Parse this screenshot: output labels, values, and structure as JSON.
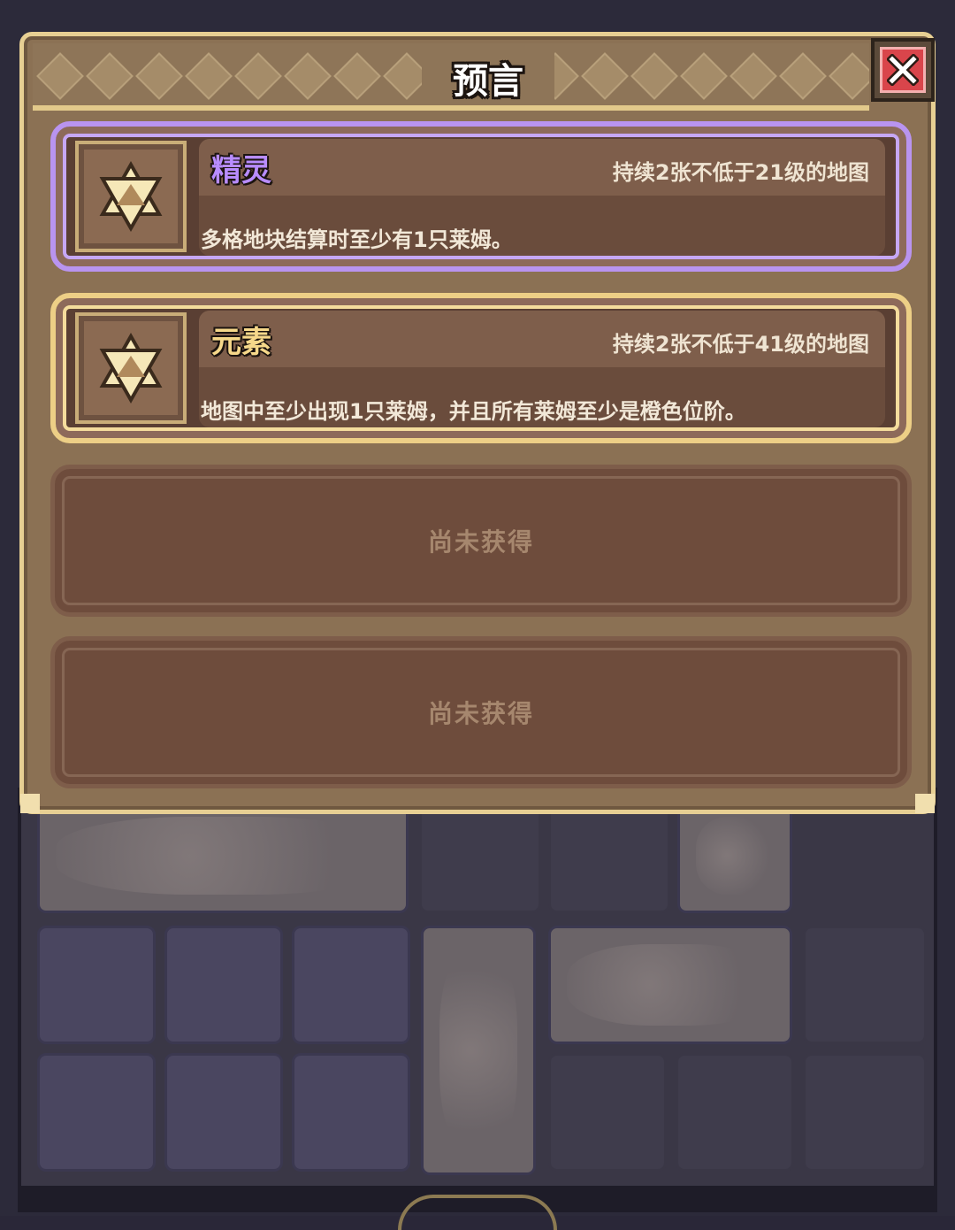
{
  "dialog": {
    "title": "预言",
    "close_icon": "close-x-icon"
  },
  "prophecies": [
    {
      "name": "精灵",
      "name_color": "#b88cff",
      "frame_color": "#b994f0",
      "duration": "持续2张不低于21级的地图",
      "description": "多格地块结算时至少有1只莱姆。",
      "icon": "hexagram-star-icon"
    },
    {
      "name": "元素",
      "name_color": "#f6d88a",
      "frame_color": "#edcf86",
      "duration": "持续2张不低于41级的地图",
      "description": "地图中至少出现1只莱姆，并且所有莱姆至少是橙色位阶。",
      "icon": "hexagram-star-icon"
    }
  ],
  "locked_slots": [
    {
      "label": "尚未获得"
    },
    {
      "label": "尚未获得"
    }
  ]
}
